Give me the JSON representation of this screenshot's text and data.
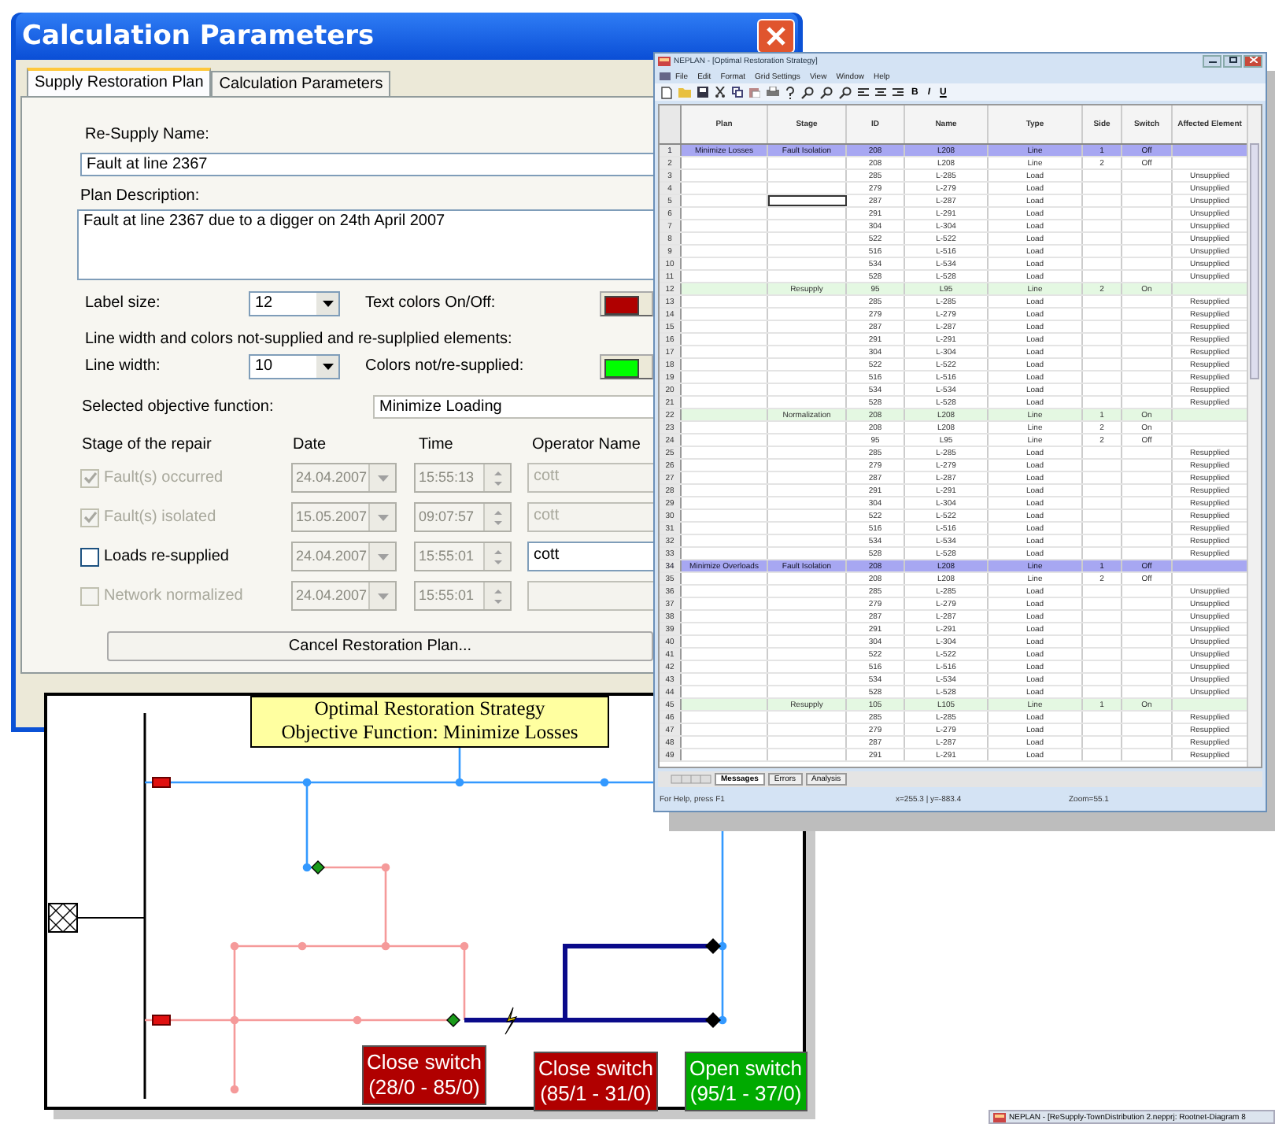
{
  "dialog": {
    "title": "Calculation Parameters",
    "tabs": [
      {
        "label": "Supply Restoration Plan",
        "selected": true
      },
      {
        "label": "Calculation Parameters",
        "selected": false
      }
    ],
    "resupply_name": {
      "label": "Re-Supply Name:",
      "value": "Fault at line 2367"
    },
    "plan_description": {
      "label": "Plan Description:",
      "value": "Fault at line 2367 due to a digger on 24th April 2007"
    },
    "label_size": {
      "label": "Label size:",
      "value": "12"
    },
    "text_colors": {
      "label": "Text colors On/Off:",
      "color": "#b00000"
    },
    "line_settings_caption": "Line width and colors not-supplied and re-suplplied elements:",
    "line_width": {
      "label": "Line width:",
      "value": "10"
    },
    "line_colors": {
      "label": "Colors not/re-supplied:",
      "color": "#00ff00"
    },
    "objective": {
      "label": "Selected objective function:",
      "value": "Minimize Loading"
    },
    "stage_columns": [
      "Stage of the repair",
      "Date",
      "Time",
      "Operator Name"
    ],
    "stages": [
      {
        "label": "Fault(s) occurred",
        "checked": true,
        "disabled": true,
        "date": "24.04.2007",
        "time": "15:55:13",
        "operator": "cott"
      },
      {
        "label": "Fault(s) isolated",
        "checked": true,
        "disabled": true,
        "date": "15.05.2007",
        "time": "09:07:57",
        "operator": "cott"
      },
      {
        "label": "Loads re-supplied",
        "checked": false,
        "disabled": false,
        "date": "24.04.2007",
        "time": "15:55:01",
        "operator": "cott"
      },
      {
        "label": "Network normalized",
        "checked": false,
        "disabled": true,
        "date": "24.04.2007",
        "time": "15:55:01"
      }
    ],
    "cancel_button": "Cancel Restoration  Plan..."
  },
  "sheet": {
    "title": "NEPLAN - [Optimal Restoration Strategy]",
    "menu": [
      "File",
      "Edit",
      "Format",
      "Grid Settings",
      "View",
      "Window",
      "Help"
    ],
    "format_buttons": [
      "B",
      "I",
      "U"
    ],
    "columns": [
      "Plan",
      "Stage",
      "ID",
      "Name",
      "Type",
      "Side",
      "Switch",
      "Affected Element"
    ],
    "rows": [
      {
        "n": "1",
        "kind": "plan",
        "selected": false,
        "plan": "Minimize Losses",
        "stage": "Fault Isolation",
        "id": "208",
        "name": "L208",
        "type": "Line",
        "side": "1",
        "switch": "Off"
      },
      {
        "n": "2",
        "kind": "detail",
        "selected": false,
        "id": "208",
        "name": "L208",
        "type": "Line",
        "side": "2",
        "switch": "Off"
      },
      {
        "n": "3",
        "kind": "detail",
        "selected": false,
        "id": "285",
        "name": "L-285",
        "type": "Load",
        "affected": "Unsupplied"
      },
      {
        "n": "4",
        "kind": "detail",
        "selected": false,
        "id": "279",
        "name": "L-279",
        "type": "Load",
        "affected": "Unsupplied"
      },
      {
        "n": "5",
        "kind": "detail",
        "selected": true,
        "id": "287",
        "name": "L-287",
        "type": "Load",
        "affected": "Unsupplied"
      },
      {
        "n": "6",
        "kind": "detail",
        "selected": false,
        "id": "291",
        "name": "L-291",
        "type": "Load",
        "affected": "Unsupplied"
      },
      {
        "n": "7",
        "kind": "detail",
        "selected": false,
        "id": "304",
        "name": "L-304",
        "type": "Load",
        "affected": "Unsupplied"
      },
      {
        "n": "8",
        "kind": "detail",
        "selected": false,
        "id": "522",
        "name": "L-522",
        "type": "Load",
        "affected": "Unsupplied"
      },
      {
        "n": "9",
        "kind": "detail",
        "selected": false,
        "id": "516",
        "name": "L-516",
        "type": "Load",
        "affected": "Unsupplied"
      },
      {
        "n": "10",
        "kind": "detail",
        "selected": false,
        "id": "534",
        "name": "L-534",
        "type": "Load",
        "affected": "Unsupplied"
      },
      {
        "n": "11",
        "kind": "detail",
        "selected": false,
        "id": "528",
        "name": "L-528",
        "type": "Load",
        "affected": "Unsupplied"
      },
      {
        "n": "12",
        "kind": "stage",
        "selected": false,
        "stage": "Resupply",
        "id": "95",
        "name": "L95",
        "type": "Line",
        "side": "2",
        "switch": "On"
      },
      {
        "n": "13",
        "kind": "detail",
        "selected": false,
        "id": "285",
        "name": "L-285",
        "type": "Load",
        "affected": "Resupplied"
      },
      {
        "n": "14",
        "kind": "detail",
        "selected": false,
        "id": "279",
        "name": "L-279",
        "type": "Load",
        "affected": "Resupplied"
      },
      {
        "n": "15",
        "kind": "detail",
        "selected": false,
        "id": "287",
        "name": "L-287",
        "type": "Load",
        "affected": "Resupplied"
      },
      {
        "n": "16",
        "kind": "detail",
        "selected": false,
        "id": "291",
        "name": "L-291",
        "type": "Load",
        "affected": "Resupplied"
      },
      {
        "n": "17",
        "kind": "detail",
        "selected": false,
        "id": "304",
        "name": "L-304",
        "type": "Load",
        "affected": "Resupplied"
      },
      {
        "n": "18",
        "kind": "detail",
        "selected": false,
        "id": "522",
        "name": "L-522",
        "type": "Load",
        "affected": "Resupplied"
      },
      {
        "n": "19",
        "kind": "detail",
        "selected": false,
        "id": "516",
        "name": "L-516",
        "type": "Load",
        "affected": "Resupplied"
      },
      {
        "n": "20",
        "kind": "detail",
        "selected": false,
        "id": "534",
        "name": "L-534",
        "type": "Load",
        "affected": "Resupplied"
      },
      {
        "n": "21",
        "kind": "detail",
        "selected": false,
        "id": "528",
        "name": "L-528",
        "type": "Load",
        "affected": "Resupplied"
      },
      {
        "n": "22",
        "kind": "stage",
        "selected": false,
        "stage": "Normalization",
        "id": "208",
        "name": "L208",
        "type": "Line",
        "side": "1",
        "switch": "On"
      },
      {
        "n": "23",
        "kind": "detail",
        "selected": false,
        "id": "208",
        "name": "L208",
        "type": "Line",
        "side": "2",
        "switch": "On"
      },
      {
        "n": "24",
        "kind": "detail",
        "selected": false,
        "id": "95",
        "name": "L95",
        "type": "Line",
        "side": "2",
        "switch": "Off"
      },
      {
        "n": "25",
        "kind": "detail",
        "selected": false,
        "id": "285",
        "name": "L-285",
        "type": "Load",
        "affected": "Resupplied"
      },
      {
        "n": "26",
        "kind": "detail",
        "selected": false,
        "id": "279",
        "name": "L-279",
        "type": "Load",
        "affected": "Resupplied"
      },
      {
        "n": "27",
        "kind": "detail",
        "selected": false,
        "id": "287",
        "name": "L-287",
        "type": "Load",
        "affected": "Resupplied"
      },
      {
        "n": "28",
        "kind": "detail",
        "selected": false,
        "id": "291",
        "name": "L-291",
        "type": "Load",
        "affected": "Resupplied"
      },
      {
        "n": "29",
        "kind": "detail",
        "selected": false,
        "id": "304",
        "name": "L-304",
        "type": "Load",
        "affected": "Resupplied"
      },
      {
        "n": "30",
        "kind": "detail",
        "selected": false,
        "id": "522",
        "name": "L-522",
        "type": "Load",
        "affected": "Resupplied"
      },
      {
        "n": "31",
        "kind": "detail",
        "selected": false,
        "id": "516",
        "name": "L-516",
        "type": "Load",
        "affected": "Resupplied"
      },
      {
        "n": "32",
        "kind": "detail",
        "selected": false,
        "id": "534",
        "name": "L-534",
        "type": "Load",
        "affected": "Resupplied"
      },
      {
        "n": "33",
        "kind": "detail",
        "selected": false,
        "id": "528",
        "name": "L-528",
        "type": "Load",
        "affected": "Resupplied"
      },
      {
        "n": "34",
        "kind": "plan",
        "selected": false,
        "plan": "Minimize Overloads",
        "stage": "Fault Isolation",
        "id": "208",
        "name": "L208",
        "type": "Line",
        "side": "1",
        "switch": "Off"
      },
      {
        "n": "35",
        "kind": "detail",
        "selected": false,
        "id": "208",
        "name": "L208",
        "type": "Line",
        "side": "2",
        "switch": "Off"
      },
      {
        "n": "36",
        "kind": "detail",
        "selected": false,
        "id": "285",
        "name": "L-285",
        "type": "Load",
        "affected": "Unsupplied"
      },
      {
        "n": "37",
        "kind": "detail",
        "selected": false,
        "id": "279",
        "name": "L-279",
        "type": "Load",
        "affected": "Unsupplied"
      },
      {
        "n": "38",
        "kind": "detail",
        "selected": false,
        "id": "287",
        "name": "L-287",
        "type": "Load",
        "affected": "Unsupplied"
      },
      {
        "n": "39",
        "kind": "detail",
        "selected": false,
        "id": "291",
        "name": "L-291",
        "type": "Load",
        "affected": "Unsupplied"
      },
      {
        "n": "40",
        "kind": "detail",
        "selected": false,
        "id": "304",
        "name": "L-304",
        "type": "Load",
        "affected": "Unsupplied"
      },
      {
        "n": "41",
        "kind": "detail",
        "selected": false,
        "id": "522",
        "name": "L-522",
        "type": "Load",
        "affected": "Unsupplied"
      },
      {
        "n": "42",
        "kind": "detail",
        "selected": false,
        "id": "516",
        "name": "L-516",
        "type": "Load",
        "affected": "Unsupplied"
      },
      {
        "n": "43",
        "kind": "detail",
        "selected": false,
        "id": "534",
        "name": "L-534",
        "type": "Load",
        "affected": "Unsupplied"
      },
      {
        "n": "44",
        "kind": "detail",
        "selected": false,
        "id": "528",
        "name": "L-528",
        "type": "Load",
        "affected": "Unsupplied"
      },
      {
        "n": "45",
        "kind": "stage",
        "selected": false,
        "stage": "Resupply",
        "id": "105",
        "name": "L105",
        "type": "Line",
        "side": "1",
        "switch": "On"
      },
      {
        "n": "46",
        "kind": "detail",
        "selected": false,
        "id": "285",
        "name": "L-285",
        "type": "Load",
        "affected": "Resupplied"
      },
      {
        "n": "47",
        "kind": "detail",
        "selected": false,
        "id": "279",
        "name": "L-279",
        "type": "Load",
        "affected": "Resupplied"
      },
      {
        "n": "48",
        "kind": "detail",
        "selected": false,
        "id": "287",
        "name": "L-287",
        "type": "Load",
        "affected": "Resupplied"
      },
      {
        "n": "49",
        "kind": "detail",
        "selected": false,
        "id": "291",
        "name": "L-291",
        "type": "Load",
        "affected": "Resupplied"
      }
    ],
    "sheet_tabs": [
      {
        "label": "Messages",
        "selected": true
      },
      {
        "label": "Errors",
        "selected": false
      },
      {
        "label": "Analysis",
        "selected": false
      }
    ],
    "status": {
      "help": "For Help, press F1",
      "coords": "x=255.3 | y=-883.4",
      "zoom": "Zoom=55.1"
    }
  },
  "diagram": {
    "title_lines": [
      "Optimal Restoration Strategy",
      "Objective Function: Minimize Losses"
    ],
    "labels": [
      {
        "action": "Close switch",
        "switches": "(28/0 - 85/0)",
        "color": "#b00000"
      },
      {
        "action": "Close switch",
        "switches": "(85/1 - 31/0)",
        "color": "#b00000"
      },
      {
        "action": "Open switch",
        "switches": "(95/1 - 37/0)",
        "color": "#00aa00"
      }
    ]
  },
  "taskbar": {
    "item": "NEPLAN - [ReSupply-TownDistribution 2.nepprj: Rootnet-Diagram 8"
  }
}
